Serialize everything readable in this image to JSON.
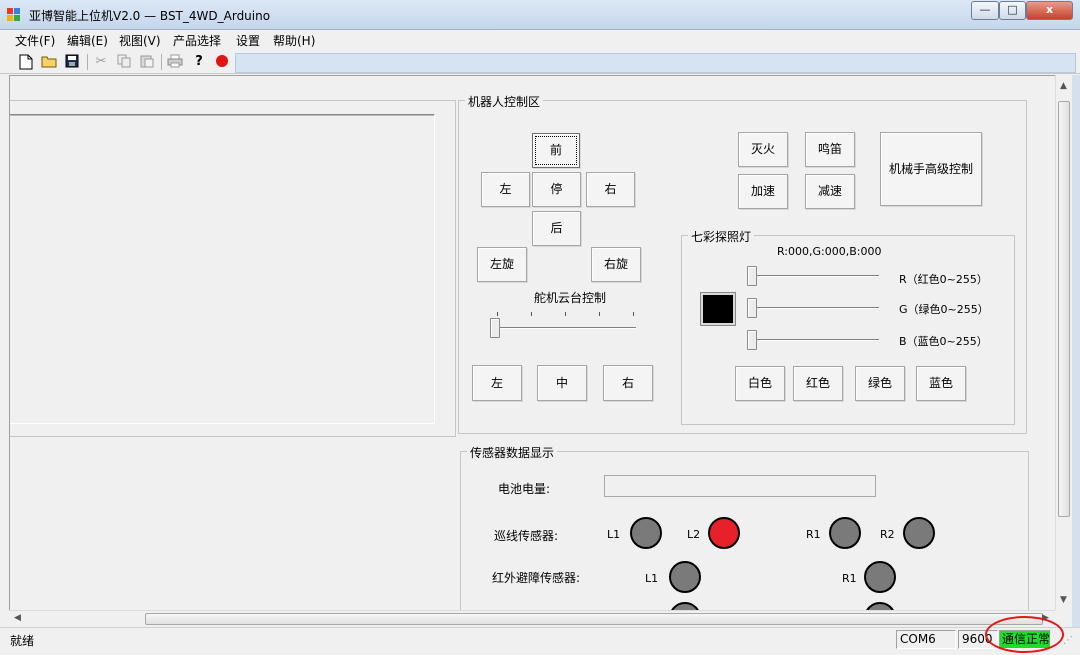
{
  "window": {
    "title": "亚博智能上位机V2.0 — BST_4WD_Arduino",
    "minimize_glyph": "—",
    "maximize_glyph": "□",
    "close_glyph": "x"
  },
  "menu": {
    "items": [
      {
        "label": "文件(F)"
      },
      {
        "label": "编辑(E)"
      },
      {
        "label": "视图(V)"
      },
      {
        "label": "产品选择"
      },
      {
        "label": "设置"
      },
      {
        "label": "帮助(H)"
      }
    ]
  },
  "toolbar": {
    "icons": [
      "new-file-icon",
      "open-folder-icon",
      "save-icon",
      "cut-icon",
      "copy-icon",
      "paste-icon",
      "print-icon",
      "help-icon",
      "record-icon"
    ]
  },
  "robot_control": {
    "title": "机器人控制区",
    "forward": "前",
    "left": "左",
    "stop": "停",
    "right": "右",
    "back": "后",
    "spin_left": "左旋",
    "spin_right": "右旋",
    "servo_title": "舵机云台控制",
    "servo_left": "左",
    "servo_center": "中",
    "servo_right": "右",
    "extinguish": "灭火",
    "horn": "鸣笛",
    "accelerate": "加速",
    "decelerate": "减速",
    "arm_advanced": "机械手高级控制"
  },
  "rgb_light": {
    "title": "七彩探照灯",
    "readout": "R:000,G:000,B:000",
    "r_label": "R（红色0~255）",
    "g_label": "G（绿色0~255）",
    "b_label": "B（蓝色0~255）",
    "r_value": 0,
    "g_value": 0,
    "b_value": 0,
    "preview_color": "#000000",
    "white": "白色",
    "red": "红色",
    "green": "绿色",
    "blue": "蓝色"
  },
  "sensors": {
    "title": "传感器数据显示",
    "battery_label": "电池电量:",
    "battery_value": "",
    "line_label": "巡线传感器:",
    "ir_label": "红外避障传感器:",
    "line_L1": "L1",
    "line_L2": "L2",
    "line_R1": "R1",
    "line_R2": "R2",
    "ir_L1": "L1",
    "ir_R1": "R1",
    "led_off_color": "#7a7a7a",
    "led_on_color": "#e8202a"
  },
  "status": {
    "ready": "就绪",
    "port": "COM6",
    "baud": "9600",
    "comm": "通信正常",
    "comm_color": "#1edc2a",
    "annotation_color": "#e01818"
  }
}
